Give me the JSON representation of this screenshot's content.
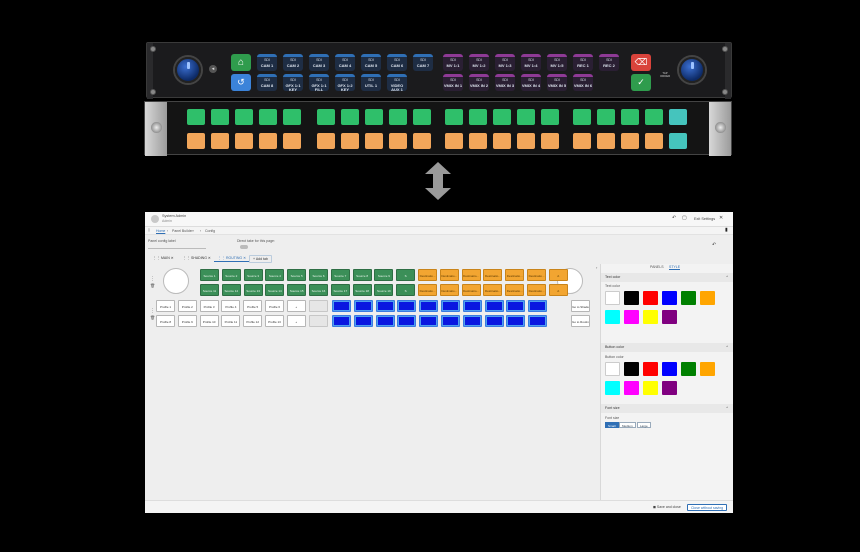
{
  "hardware_top": {
    "cam_buttons_top": [
      {
        "t1": "SDI",
        "t2": "CAM 1"
      },
      {
        "t1": "SDI",
        "t2": "CAM 2"
      },
      {
        "t1": "SDI",
        "t2": "CAM 3"
      },
      {
        "t1": "SDI",
        "t2": "CAM 4"
      },
      {
        "t1": "SDI",
        "t2": "CAM 5"
      },
      {
        "t1": "SDI",
        "t2": "CAM 6"
      },
      {
        "t1": "SDI",
        "t2": "CAM 7"
      }
    ],
    "src_buttons_top": [
      {
        "t1": "SDI",
        "t2": "MV 1:1"
      },
      {
        "t1": "SDI",
        "t2": "MV 1:2"
      },
      {
        "t1": "SDI",
        "t2": "MV 1:3"
      },
      {
        "t1": "SDI",
        "t2": "MV 1:4"
      },
      {
        "t1": "SDI",
        "t2": "MV 1:5"
      },
      {
        "t1": "SDI",
        "t2": "REC 1"
      },
      {
        "t1": "SDI",
        "t2": "REC 2"
      }
    ],
    "cam_buttons_bottom": [
      {
        "t1": "SDI",
        "t2": "CAM 8"
      },
      {
        "t1": "SDI",
        "t2": "GFX 1:1 KEY"
      },
      {
        "t1": "SDI",
        "t2": "GFX 1:1 FILL"
      },
      {
        "t1": "SDI",
        "t2": "GFX 1:2 KEY"
      },
      {
        "t1": "SDI",
        "t2": "UTIL 1"
      },
      {
        "t1": "SDI",
        "t2": "VIDEO AUX 1"
      }
    ],
    "src_buttons_bottom": [
      {
        "t1": "SDI",
        "t2": "VMIX IN 1"
      },
      {
        "t1": "SDI",
        "t2": "VMIX IN 2"
      },
      {
        "t1": "SDI",
        "t2": "VMIX IN 3"
      },
      {
        "t1": "SDI",
        "t2": "VMIX IN 4"
      },
      {
        "t1": "SDI",
        "t2": "VMIX IN 5"
      },
      {
        "t1": "SDI",
        "t2": "VMIX IN 6"
      }
    ],
    "side_label": "TAP ORDER"
  },
  "window": {
    "user_name": "System Admin",
    "user_role": "Admin",
    "exit_label": "Exit Settings",
    "breadcrumbs": [
      "Home",
      "Panel Builder",
      "Config"
    ]
  },
  "config": {
    "label_caption": "Panel config label",
    "direct_take_caption": "Direct take for this page:",
    "tabs": [
      {
        "label": "MAIN"
      },
      {
        "label": "SHADING"
      },
      {
        "label": "ROUTING"
      }
    ],
    "add_tab_label": "Add tab"
  },
  "grid": {
    "row1_green": [
      "Source 1",
      "Source 2",
      "Source 3",
      "Source 4",
      "Source 5",
      "Source 6",
      "Source 7",
      "Source 8",
      "Source 9",
      "S"
    ],
    "row1_orange": [
      "Destinatio...",
      "Destinatio...",
      "Destinatio...",
      "Destinatio...",
      "Destinatio...",
      "Destinatio...",
      "A"
    ],
    "row2_green": [
      "Source 11",
      "Source 12",
      "Source 13",
      "Source 14",
      "Source 15",
      "Source 16",
      "Source 17",
      "Source 18",
      "Source 19",
      "S"
    ],
    "row2_orange": [
      "Destinatio...",
      "Destinatio...",
      "Destinatio...",
      "Destinatio...",
      "Destinatio...",
      "Destinatio...",
      "A"
    ],
    "row3_white": [
      "Profile 1",
      "Profile 2",
      "Profile 3",
      "Profile 4",
      "Profile 5",
      "Profile 6",
      "+"
    ],
    "row4_white": [
      "Profile 8",
      "Profile 9",
      "Profile 10",
      "Profile 11",
      "Profile 12",
      "Profile 13",
      "+"
    ],
    "right_labels": [
      "Go to Shade",
      "Go to Routing"
    ]
  },
  "right_panel": {
    "tabs": [
      "PANELS",
      "STYLE"
    ],
    "text_color_section": "Text color",
    "text_color_label": "Text color",
    "button_color_section": "Button color",
    "button_color_label": "Button color",
    "colors": [
      "#ffffff",
      "#000000",
      "#ff0000",
      "#0000ff",
      "#008000",
      "#ffa500",
      "#00ffff",
      "#ff00ff",
      "#ffff00",
      "#800080"
    ],
    "font_size_section": "Font size",
    "font_size_label": "Font size",
    "font_sizes": [
      "Small",
      "Medium",
      "Large"
    ]
  },
  "footer": {
    "save_close": "Save and close",
    "close_without": "Close without saving"
  }
}
